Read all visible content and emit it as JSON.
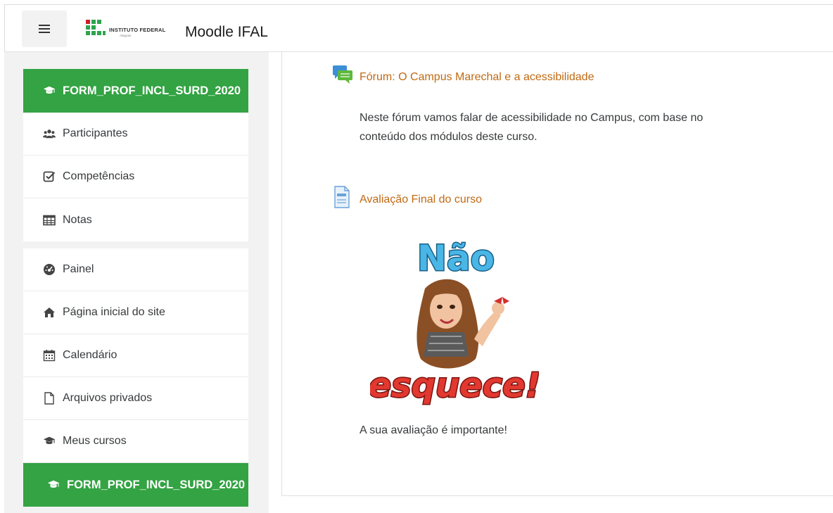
{
  "navbar": {
    "menu_icon": "hamburger-icon",
    "brand_institution": "INSTITUTO FEDERAL",
    "brand_campus": "Alagoas",
    "brand_name": "Moodle IFAL"
  },
  "course_nav": {
    "course_short": "FORM_PROF_INCL_SURD_2020",
    "items": [
      {
        "label": "Participantes",
        "icon": "users-icon"
      },
      {
        "label": "Competências",
        "icon": "checkbox-icon"
      },
      {
        "label": "Notas",
        "icon": "table-icon"
      }
    ]
  },
  "site_nav": {
    "items": [
      {
        "label": "Painel",
        "icon": "dashboard-icon"
      },
      {
        "label": "Página inicial do site",
        "icon": "home-icon"
      },
      {
        "label": "Calendário",
        "icon": "calendar-icon"
      },
      {
        "label": "Arquivos privados",
        "icon": "file-icon"
      },
      {
        "label": "Meus cursos",
        "icon": "graduation-cap-icon"
      }
    ],
    "course_short": "FORM_PROF_INCL_SURD_2020"
  },
  "content": {
    "forum": {
      "title": "Fórum: O Campus Marechal e a acessibilidade",
      "desc_line1": "Neste fórum vamos falar de acessibilidade no Campus, com base no",
      "desc_line2": "conteúdo dos módulos deste curso.",
      "icon": "forum-icon"
    },
    "evaluation": {
      "title": "Avaliação Final do curso",
      "icon": "feedback-icon",
      "sticker_top": "Não",
      "sticker_bottom": "esquece!",
      "note": "A sua avaliação é importante!"
    }
  },
  "colors": {
    "accent_green": "#33a343",
    "link_orange": "#c06a14"
  }
}
